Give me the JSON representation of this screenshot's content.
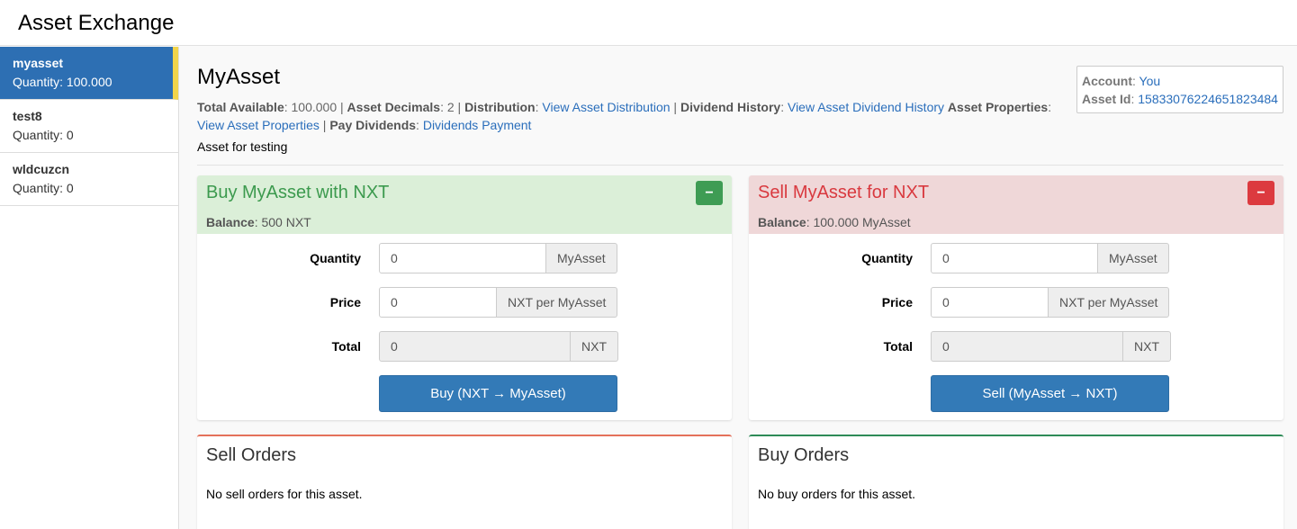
{
  "app": {
    "title": "Asset Exchange"
  },
  "sidebar": {
    "items": [
      {
        "name": "myasset",
        "quantity": "Quantity: 100.000",
        "active": true
      },
      {
        "name": "test8",
        "quantity": "Quantity: 0",
        "active": false
      },
      {
        "name": "wldcuzcn",
        "quantity": "Quantity: 0",
        "active": false
      }
    ]
  },
  "asset": {
    "title": "MyAsset",
    "total_available_label": "Total Available",
    "total_available": "100.000",
    "decimals_label": "Asset Decimals",
    "decimals": "2",
    "distribution_label": "Distribution",
    "distribution_link": "View Asset Distribution",
    "dividend_history_label": "Dividend History",
    "dividend_history_link": "View Asset Dividend History",
    "properties_label": "Asset Properties",
    "properties_link": "View Asset Properties",
    "pay_dividends_label": "Pay Dividends",
    "pay_dividends_link": "Dividends Payment",
    "description": "Asset for testing"
  },
  "account_box": {
    "account_label": "Account",
    "account_value": "You",
    "asset_id_label": "Asset Id",
    "asset_id_value": "15833076224651823484"
  },
  "buy": {
    "title": "Buy MyAsset with NXT",
    "balance_label": "Balance",
    "balance_value": "500 NXT",
    "collapse_symbol": "−",
    "quantity_label": "Quantity",
    "quantity_value": "0",
    "quantity_unit": "MyAsset",
    "price_label": "Price",
    "price_value": "0",
    "price_unit": "NXT per MyAsset",
    "total_label": "Total",
    "total_value": "0",
    "total_unit": "NXT",
    "button": "Buy (NXT → MyAsset)"
  },
  "sell": {
    "title": "Sell MyAsset for NXT",
    "balance_label": "Balance",
    "balance_value": "100.000 MyAsset",
    "collapse_symbol": "−",
    "quantity_label": "Quantity",
    "quantity_value": "0",
    "quantity_unit": "MyAsset",
    "price_label": "Price",
    "price_value": "0",
    "price_unit": "NXT per MyAsset",
    "total_label": "Total",
    "total_value": "0",
    "total_unit": "NXT",
    "button": "Sell (MyAsset → NXT)"
  },
  "sell_orders": {
    "title": "Sell Orders",
    "empty": "No sell orders for this asset."
  },
  "buy_orders": {
    "title": "Buy Orders",
    "empty": "No buy orders for this asset."
  },
  "colors": {
    "accent": "#337ab7",
    "buy": "#3c9a4e",
    "sell": "#d9393f",
    "active_marker": "#f2d44a"
  }
}
